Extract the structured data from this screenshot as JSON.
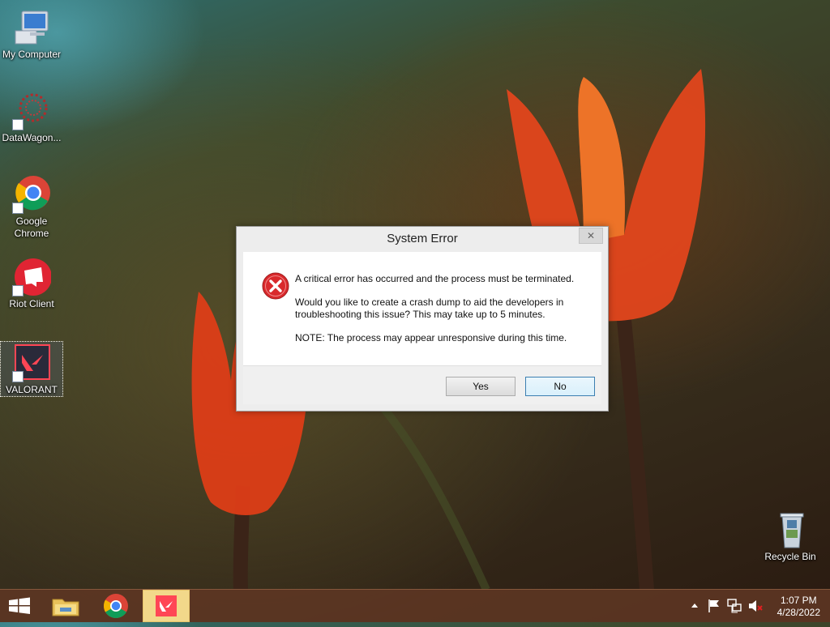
{
  "desktop": {
    "icons": [
      {
        "label": "My Computer",
        "icon": "computer-icon"
      },
      {
        "label": "DataWagon...",
        "icon": "datawagon-icon"
      },
      {
        "label": "Google Chrome",
        "icon": "chrome-icon"
      },
      {
        "label": "Riot Client",
        "icon": "riot-client-icon"
      },
      {
        "label": "VALORANT",
        "icon": "valorant-icon"
      },
      {
        "label": "Recycle Bin",
        "icon": "recycle-bin-icon"
      }
    ]
  },
  "dialog": {
    "title": "System Error",
    "close_glyph": "✕",
    "icon": "error-icon",
    "messages": [
      "A critical error has occurred and the process must be terminated.",
      "Would you like to create a crash dump to aid the developers in troubleshooting this issue? This may take up to 5 minutes.",
      "NOTE: The process may appear unresponsive during this time."
    ],
    "buttons": {
      "yes": "Yes",
      "no": "No"
    }
  },
  "taskbar": {
    "items": [
      "start-icon",
      "file-explorer-icon",
      "chrome-icon",
      "valorant-icon"
    ],
    "active_item": "valorant-icon",
    "tray_icons": [
      "show-hidden-icon",
      "action-center-flag-icon",
      "network-icon",
      "volume-muted-icon"
    ],
    "time": "1:07 PM",
    "date": "4/28/2022"
  },
  "colors": {
    "error_red": "#d9292c",
    "valorant_red": "#ff4655",
    "taskbar": "#5f3723"
  }
}
